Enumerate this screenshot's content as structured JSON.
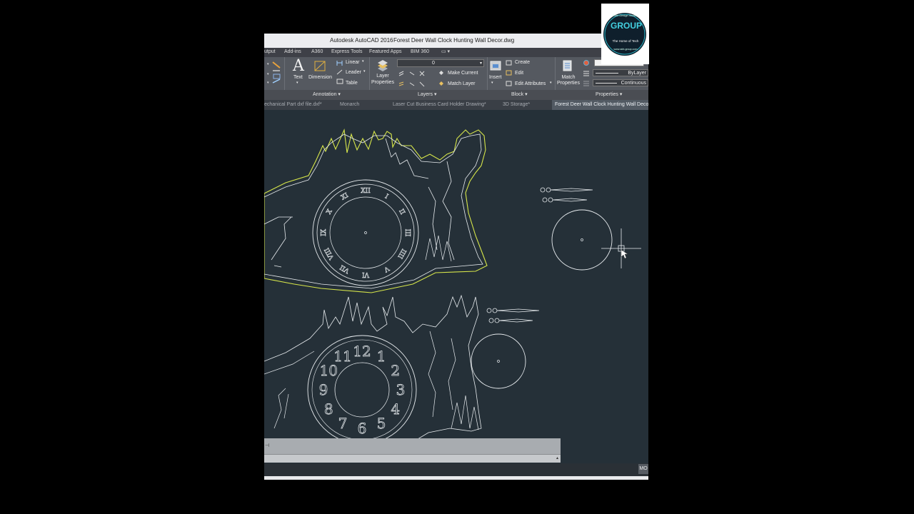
{
  "window": {
    "app_name": "Autodesk AutoCAD 2016",
    "document_name": "Forest Deer Wall Clock Hunting Wall Decor.dwg"
  },
  "ribbon_tabs": [
    "utput",
    "Add-ins",
    "A360",
    "Express Tools",
    "Featured Apps",
    "BIM 360"
  ],
  "ribbon": {
    "annotation": {
      "text_label": "Text",
      "dimension_label": "Dimension",
      "linear_label": "Linear",
      "leader_label": "Leader",
      "table_label": "Table",
      "panel_label": "Annotation"
    },
    "layers": {
      "layer_properties_label_1": "Layer",
      "layer_properties_label_2": "Properties",
      "current_layer": "0",
      "make_current_label": "Make Current",
      "match_layer_label": "Match Layer",
      "panel_label": "Layers"
    },
    "block": {
      "insert_label": "Insert",
      "create_label": "Create",
      "edit_label": "Edit",
      "edit_attributes_label": "Edit Attributes",
      "panel_label": "Block"
    },
    "properties": {
      "match_properties_label_1": "Match",
      "match_properties_label_2": "Properties",
      "lineweight_value": "ByLayer",
      "linetype_value": "Continuous",
      "panel_label": "Properties"
    }
  },
  "doc_tabs": [
    "echanical Part dxf file.dxf*",
    "Monarch",
    "Laser Cut Business Card Holder Drawing*",
    "3D Storage*",
    "Forest Deer Wall Clock Hunting Wall Deco"
  ],
  "clock_numerals": [
    "12",
    "1",
    "2",
    "3",
    "4",
    "5",
    "6",
    "7",
    "8",
    "9",
    "10",
    "11"
  ],
  "roman_numerals": [
    "XII",
    "I",
    "II",
    "III",
    "IIII",
    "V",
    "VI",
    "VII",
    "VIII",
    "IX",
    "X",
    "XI"
  ],
  "statusbar": {
    "model_label": "MO"
  },
  "logo": {
    "top_text": "Rabt Design Studio",
    "word": "GROUP",
    "subtitle": "The Home of Tech",
    "bottom_text": "www.rabt-group.com"
  },
  "colors": {
    "canvas_bg": "#253038",
    "selection_yellow": "#d7e64a",
    "drawing_white": "#e8ecef"
  }
}
